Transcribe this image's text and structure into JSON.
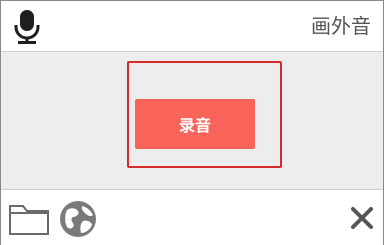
{
  "header": {
    "title": "画外音",
    "mic_icon": "microphone-icon"
  },
  "main": {
    "record_label": "录音",
    "record_button_color": "#f8645a",
    "highlight_color": "#d42a2a"
  },
  "footer": {
    "icons": [
      "folder-icon",
      "globe-icon",
      "close-icon"
    ]
  }
}
